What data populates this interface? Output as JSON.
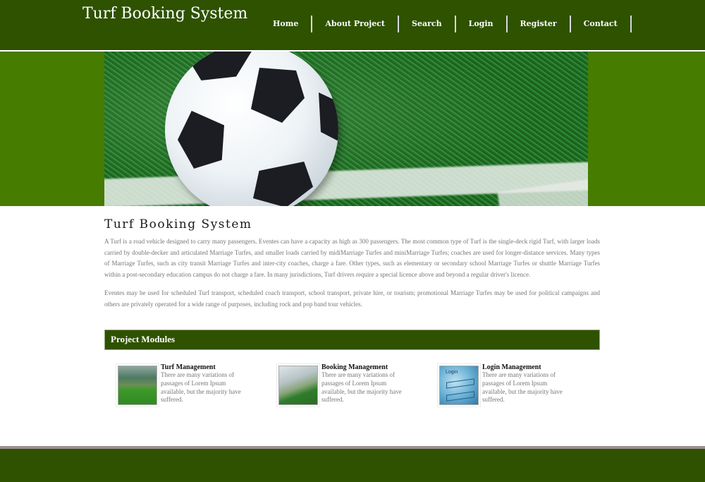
{
  "header": {
    "site_title": "Turf Booking System",
    "nav": [
      {
        "label": "Home"
      },
      {
        "label": "About Project"
      },
      {
        "label": "Search"
      },
      {
        "label": "Login"
      },
      {
        "label": "Register"
      },
      {
        "label": "Contact"
      }
    ]
  },
  "banner": {
    "image_subject": "soccer-ball-on-turf"
  },
  "main": {
    "heading": "Turf Booking System",
    "paragraphs": [
      "A Turf is a road vehicle designed to carry many passengers. Eventes can have a capacity as high as 300 passengers. The most common type of Turf is the single-deck rigid Turf, with larger loads carried by double-decker and articulated Marriage Turfes, and smaller loads carried by midiMarriage Turfes and miniMarriage Turfes; coaches are used for longer-distance services. Many types of Marriage Turfes, such as city transit Marriage Turfes and inter-city coaches, charge a fare. Other types, such as elementary or secondary school Marriage Turfes or shuttle Marriage Turfes within a post-secondary education campus do not charge a fare. In many jurisdictions, Turf drivers require a special licence above and beyond a regular driver's licence.",
      "Eventes may be used for scheduled Turf transport, scheduled coach transport, school transport, private hire, or tourism; promotional Marriage Turfes may be used for political campaigns and others are privately operated for a wide range of purposes, including rock and pop band tour vehicles."
    ]
  },
  "modules": {
    "title": "Project Modules",
    "items": [
      {
        "title": "Turf Management",
        "description": "There are many variations of passages of Lorem Ipsum available, but the majority have suffered.",
        "thumbnail": "turf-photo"
      },
      {
        "title": "Booking Management",
        "description": "There are many variations of passages of Lorem Ipsum available, but the majority have suffered.",
        "thumbnail": "players-photo"
      },
      {
        "title": "Login Management",
        "description": "There are many variations of passages of Lorem Ipsum available, but the majority have suffered.",
        "thumbnail": "login-screen-image",
        "thumbnail_text": "Login"
      }
    ]
  },
  "colors": {
    "header_bg": "#2e5200",
    "banner_band": "#467c00",
    "footer_bg": "#2e5200",
    "footer_line": "#a09090"
  }
}
